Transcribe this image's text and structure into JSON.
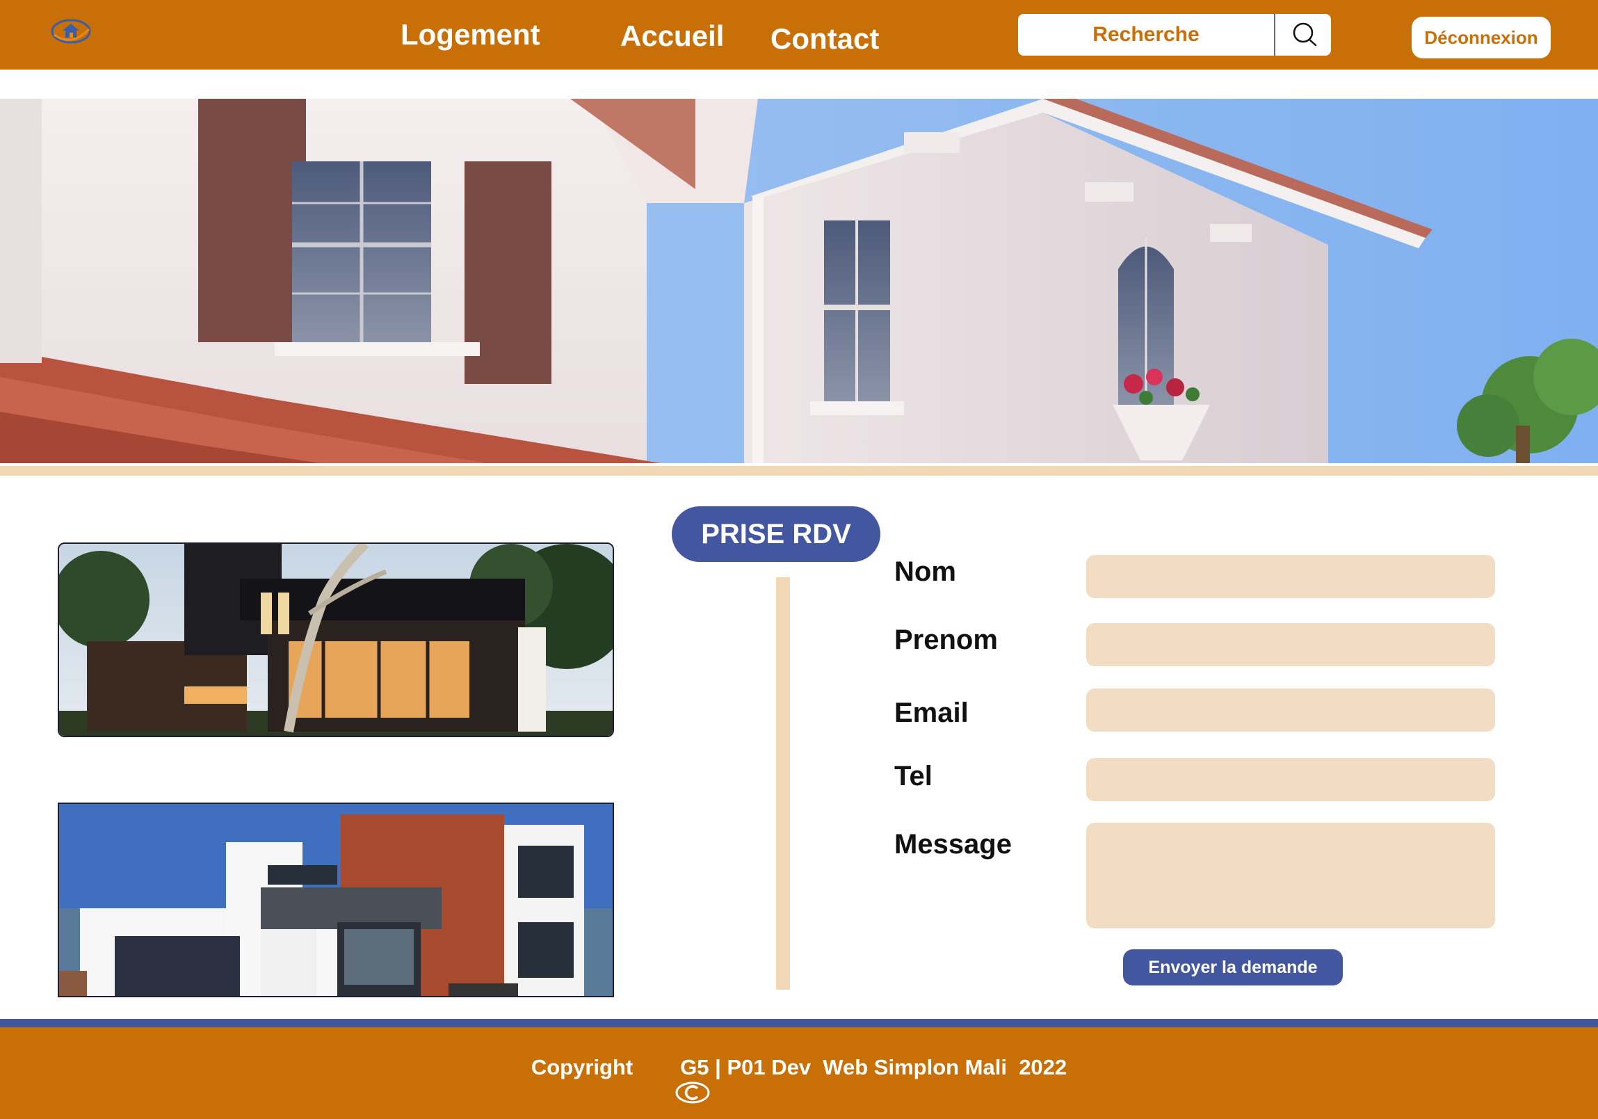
{
  "header": {
    "nav": {
      "logement": "Logement",
      "accueil": "Accueil",
      "contact": "Contact"
    },
    "search": {
      "placeholder": "Recherche",
      "icon": "search-icon"
    },
    "logout_label": "Déconnexion"
  },
  "main": {
    "badge": "PRISE RDV",
    "form": {
      "nom_label": "Nom",
      "prenom_label": "Prenom",
      "email_label": "Email",
      "tel_label": "Tel",
      "message_label": "Message",
      "nom_value": "",
      "prenom_value": "",
      "email_value": "",
      "tel_value": "",
      "message_value": "",
      "submit_label": "Envoyer la demande"
    }
  },
  "footer": {
    "copyright_prefix": "Copyright",
    "copyright_icon": "copyright-icon",
    "copyright_rest": "G5 | P01 Dev  Web Simplon Mali  2022"
  },
  "colors": {
    "brand_orange": "#c96f07",
    "accent_blue": "#4357a0",
    "field_beige": "#f2ddc4",
    "stripe_beige": "#f2d7b5"
  }
}
